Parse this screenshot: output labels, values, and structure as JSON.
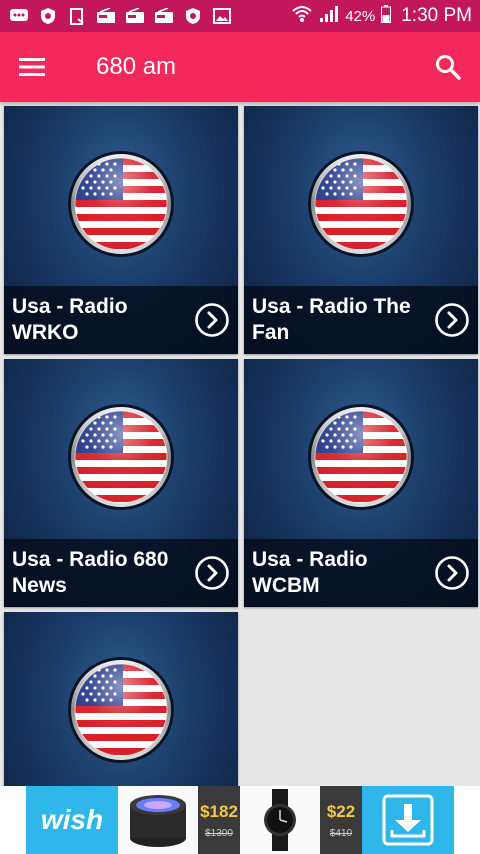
{
  "status_bar": {
    "battery": "42%",
    "time": "1:30 PM",
    "icons": [
      "message-icon",
      "shield-icon",
      "clipboard-icon",
      "radio-icon",
      "radio-icon",
      "radio-icon",
      "shield-icon",
      "image-icon",
      "wifi-icon",
      "signal-icon",
      "battery-icon"
    ]
  },
  "app_bar": {
    "title": "680 am",
    "menu_icon": "menu-icon",
    "search_icon": "search-icon"
  },
  "stations": [
    {
      "label": "Usa - Radio WRKO"
    },
    {
      "label": "Usa - Radio The Fan"
    },
    {
      "label": "Usa - Radio 680 News"
    },
    {
      "label": "Usa - Radio WCBM"
    },
    {
      "label": ""
    }
  ],
  "ad": {
    "brand": "wish",
    "price1": "$182",
    "old_price1": "$1300",
    "price2": "$22",
    "old_price2": "$410"
  },
  "colors": {
    "accent": "#f4285a",
    "status": "#c2185b",
    "card_bg": "#1a3a66",
    "ad_blue": "#2fb7ec"
  }
}
